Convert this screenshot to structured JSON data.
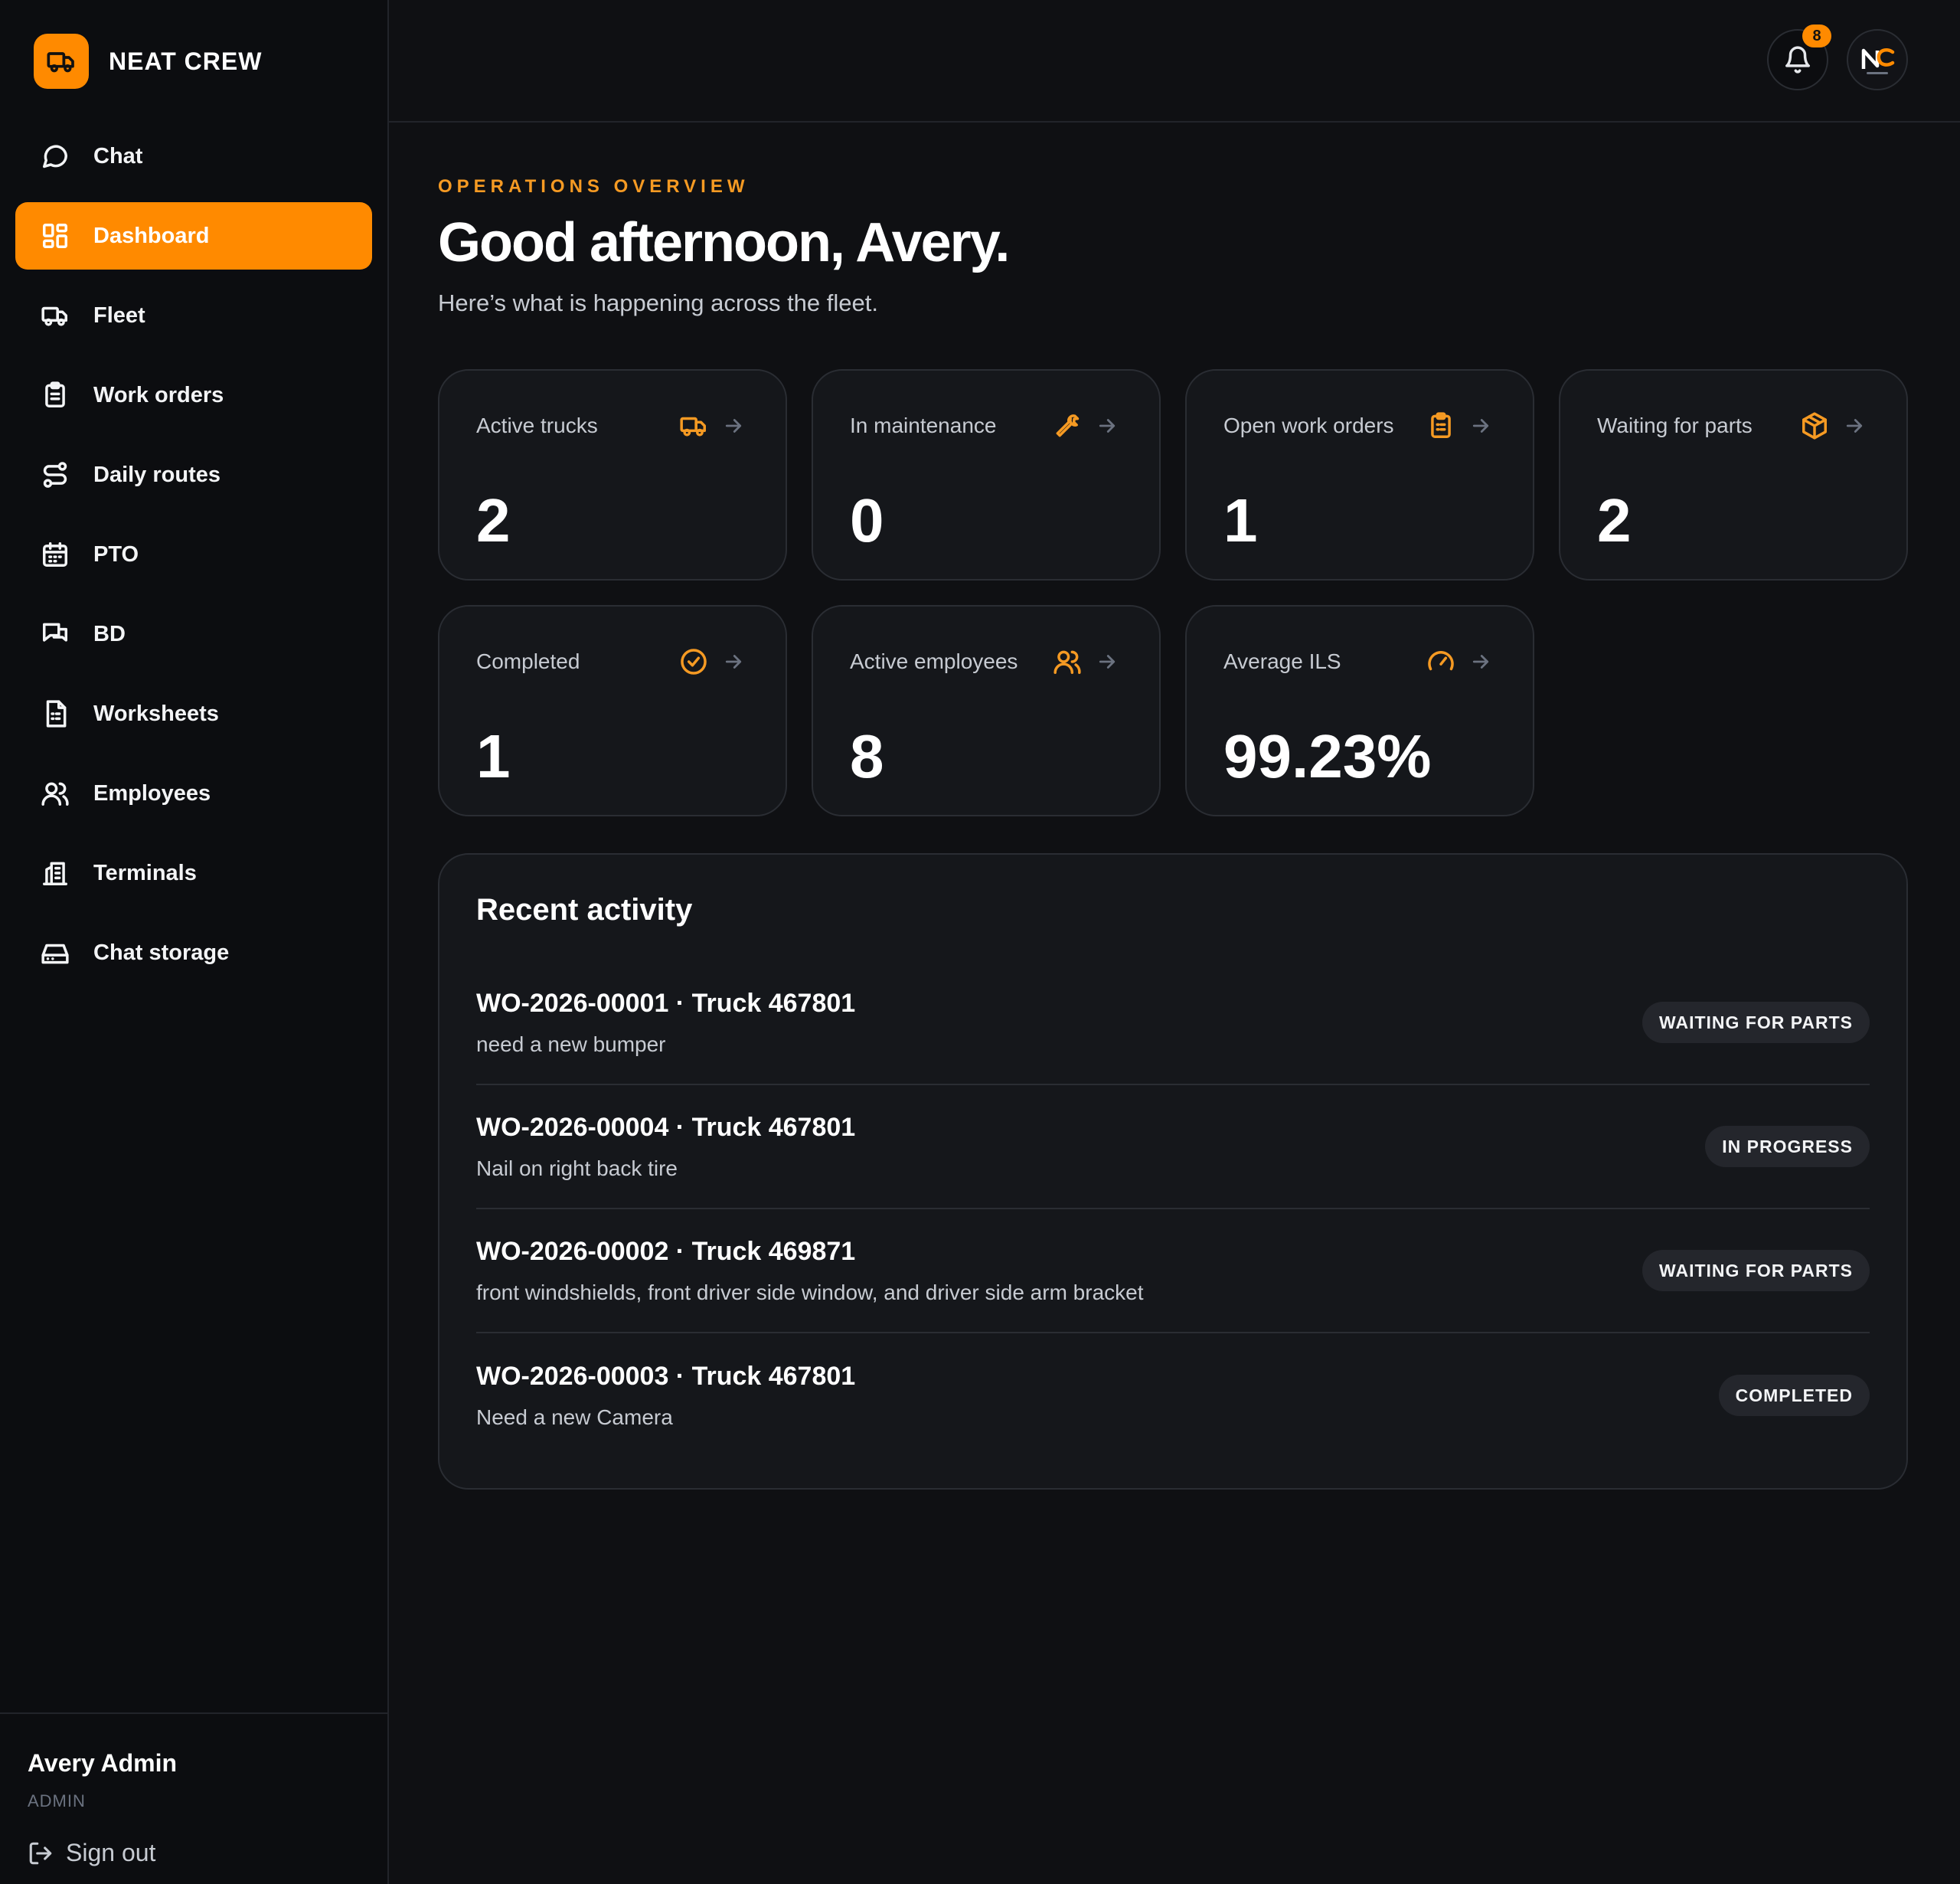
{
  "brand": {
    "name": "NEAT CREW"
  },
  "sidebar": {
    "items": [
      {
        "label": "Chat",
        "icon": "chat-icon"
      },
      {
        "label": "Dashboard",
        "icon": "grid-icon"
      },
      {
        "label": "Fleet",
        "icon": "truck-icon"
      },
      {
        "label": "Work orders",
        "icon": "clipboard-icon"
      },
      {
        "label": "Daily routes",
        "icon": "route-icon"
      },
      {
        "label": "PTO",
        "icon": "calendar-icon"
      },
      {
        "label": "BD",
        "icon": "messages-icon"
      },
      {
        "label": "Worksheets",
        "icon": "document-icon"
      },
      {
        "label": "Employees",
        "icon": "users-icon"
      },
      {
        "label": "Terminals",
        "icon": "building-icon"
      },
      {
        "label": "Chat storage",
        "icon": "hard-drive-icon"
      }
    ],
    "active": "Dashboard"
  },
  "user": {
    "name": "Avery Admin",
    "role": "ADMIN",
    "signout": "Sign out"
  },
  "topbar": {
    "notifications": "8"
  },
  "header": {
    "eyebrow": "OPERATIONS OVERVIEW",
    "greeting": "Good afternoon, Avery.",
    "subtitle": "Here’s what is happening across the fleet."
  },
  "stats": [
    {
      "label": "Active trucks",
      "value": "2",
      "icon": "truck-icon"
    },
    {
      "label": "In maintenance",
      "value": "0",
      "icon": "wrench-icon"
    },
    {
      "label": "Open work orders",
      "value": "1",
      "icon": "clipboard-icon"
    },
    {
      "label": "Waiting for parts",
      "value": "2",
      "icon": "package-icon"
    },
    {
      "label": "Completed",
      "value": "1",
      "icon": "check-circle-icon"
    },
    {
      "label": "Active employees",
      "value": "8",
      "icon": "users-icon"
    },
    {
      "label": "Average ILS",
      "value": "99.23%",
      "icon": "gauge-icon"
    }
  ],
  "activity": {
    "title": "Recent activity",
    "rows": [
      {
        "title": "WO-2026-00001 · Truck 467801",
        "desc": "need a new bumper",
        "status": "WAITING FOR PARTS"
      },
      {
        "title": "WO-2026-00004 · Truck 467801",
        "desc": "Nail on right back tire",
        "status": "IN PROGRESS"
      },
      {
        "title": "WO-2026-00002 · Truck 469871",
        "desc": "front windshields, front driver side window, and driver side arm bracket",
        "status": "WAITING FOR PARTS"
      },
      {
        "title": "WO-2026-00003 · Truck 467801",
        "desc": "Need a new Camera",
        "status": "COMPLETED"
      }
    ]
  },
  "colors": {
    "accent": "#ff8a00",
    "background": "#0f1013",
    "card": "#15171b"
  }
}
